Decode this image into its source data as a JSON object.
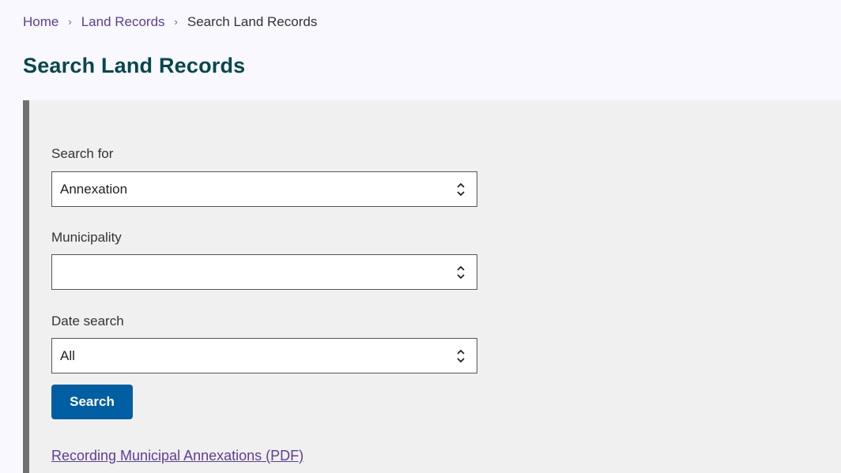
{
  "breadcrumb": {
    "items": [
      {
        "label": "Home",
        "link": true
      },
      {
        "label": "Land Records",
        "link": true
      },
      {
        "label": "Search Land Records",
        "link": false
      }
    ],
    "separator_icon": "chevron-right-icon"
  },
  "page": {
    "title": "Search Land Records"
  },
  "form": {
    "search_for": {
      "label": "Search for",
      "value": "Annexation"
    },
    "municipality": {
      "label": "Municipality",
      "value": ""
    },
    "date_search": {
      "label": "Date search",
      "value": "All"
    },
    "search_button": "Search",
    "pdf_link": "Recording Municipal Annexations (PDF)"
  },
  "colors": {
    "link": "#5c3e94",
    "title": "#05474f",
    "button": "#005ea2",
    "panel_border": "#707070"
  }
}
